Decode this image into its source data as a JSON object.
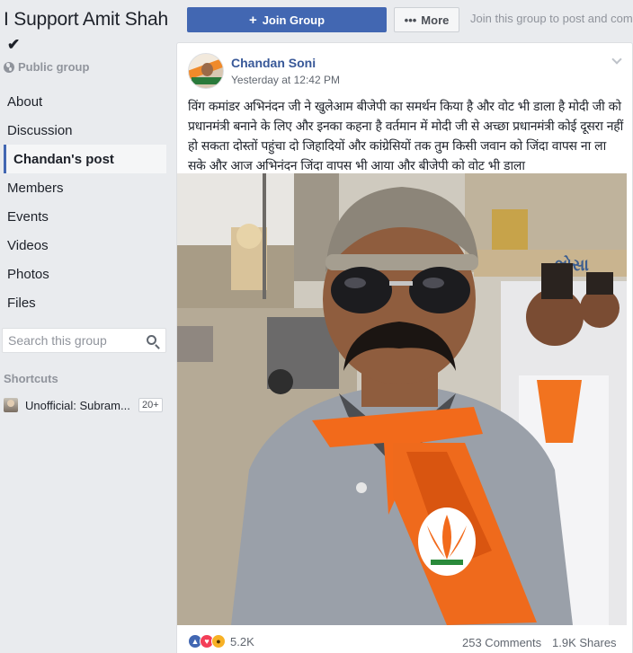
{
  "group": {
    "title": "I Support Amit Shah",
    "verified_mark": "✔",
    "privacy": "Public group"
  },
  "nav": {
    "items": [
      {
        "label": "About",
        "active": false
      },
      {
        "label": "Discussion",
        "active": false
      },
      {
        "label": "Chandan's post",
        "active": true
      },
      {
        "label": "Members",
        "active": false
      },
      {
        "label": "Events",
        "active": false
      },
      {
        "label": "Videos",
        "active": false
      },
      {
        "label": "Photos",
        "active": false
      },
      {
        "label": "Files",
        "active": false
      }
    ]
  },
  "search": {
    "placeholder": "Search this group",
    "value": ""
  },
  "shortcuts": {
    "label": "Shortcuts",
    "items": [
      {
        "label": "Unofficial: Subram...",
        "badge": "20+"
      }
    ]
  },
  "actions": {
    "join_label": "Join Group",
    "join_icon": "+",
    "more_label": "More",
    "more_icon": "•••",
    "hint": "Join this group to post and comment"
  },
  "post": {
    "author": "Chandan Soni",
    "time": "Yesterday at 12:42 PM",
    "text": "विंग कमांडर अभिनंदन जी ने खुलेआम बीजेपी का समर्थन किया है और वोट भी डाला है मोदी जी को प्रधानमंत्री बनाने के लिए और इनका कहना है वर्तमान में मोदी जी से अच्छा प्रधानमंत्री कोई दूसरा नहीं हो सकता दोस्तों पहुंचा दो जिहादियों और कांग्रेसियों तक तुम किसी जवान को जिंदा वापस ना ला सके और आज अभिनंदन जिंदा वापस भी आया और बीजेपी को वोट भी डाला",
    "photo_sign_text": "ભોસા",
    "reactions": {
      "icons": [
        "like-icon",
        "love-icon",
        "wow-icon"
      ],
      "count": "5.2K"
    },
    "comments": "253 Comments",
    "shares": "1.9K Shares"
  },
  "colors": {
    "brand_blue": "#4267b2",
    "link_blue": "#385898",
    "background": "#e9ebee",
    "scarf_orange": "#f26a1b"
  }
}
